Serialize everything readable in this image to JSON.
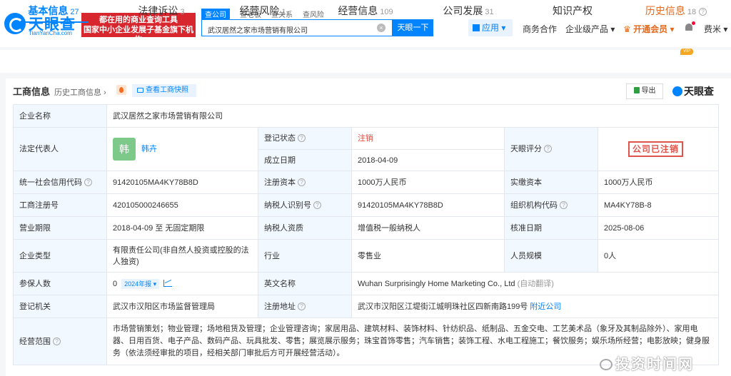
{
  "header": {
    "logo_name": "天眼查",
    "logo_sub": "TianYanCha.com",
    "banner_line1": "都在用的商业查询工具",
    "banner_line2": "国家中小企业发展子基金旗下机构",
    "search_tabs": [
      "查公司",
      "查老板",
      "查关系",
      "查风险"
    ],
    "search_value": "武汉居然之家市场营销有限公司",
    "search_button": "天眼一下",
    "app_menu": "应用",
    "nav": [
      "商务合作",
      "企业级产品"
    ],
    "vip": "开通会员",
    "user": "费米"
  },
  "tabs": [
    {
      "label": "基本信息",
      "count": "27"
    },
    {
      "label": "法律诉讼",
      "count": "3"
    },
    {
      "label": "经营风险",
      "count": "1"
    },
    {
      "label": "经营信息",
      "count": "109"
    },
    {
      "label": "公司发展",
      "count": "31"
    },
    {
      "label": "知识产权",
      "count": ""
    },
    {
      "label": "历史信息",
      "count": "18",
      "badge": "VIP"
    }
  ],
  "panel": {
    "title": "工商信息",
    "history_link": "历史工商信息",
    "snapshot_button": "查看工商快照",
    "export_button": "导出",
    "brand": "天眼查"
  },
  "info": {
    "company_name_label": "企业名称",
    "company_name": "武汉居然之家市场营销有限公司",
    "legal_rep_label": "法定代表人",
    "legal_rep_avatar": "韩",
    "legal_rep": "韩卉",
    "reg_status_label": "登记状态",
    "reg_status": "注销",
    "founded_label": "成立日期",
    "founded": "2018-04-09",
    "score_label": "天眼评分",
    "score_stamp": "公司已注销",
    "credit_code_label": "统一社会信用代码",
    "credit_code": "91420105MA4KY78B8D",
    "reg_capital_label": "注册资本",
    "reg_capital": "1000万人民币",
    "paid_capital_label": "实缴资本",
    "paid_capital": "1000万人民币",
    "reg_no_label": "工商注册号",
    "reg_no": "420105000246655",
    "taxpayer_id_label": "纳税人识别号",
    "taxpayer_id": "91420105MA4KY78B8D",
    "org_code_label": "组织机构代码",
    "org_code": "MA4KY78B-8",
    "term_label": "营业期限",
    "term": "2018-04-09 至 无固定期限",
    "taxpayer_type_label": "纳税人资质",
    "taxpayer_type": "增值税一般纳税人",
    "approval_date_label": "核准日期",
    "approval_date": "2025-08-06",
    "company_type_label": "企业类型",
    "company_type": "有限责任公司(非自然人投资或控股的法人独资)",
    "industry_label": "行业",
    "industry": "零售业",
    "staff_size_label": "人员规模",
    "staff_size": "0人",
    "insured_label": "参保人数",
    "insured": "0",
    "insured_year": "2024年报",
    "en_name_label": "英文名称",
    "en_name": "Wuhan Surprisingly Home Marketing Co., Ltd",
    "auto_translate": "(自动翻译)",
    "authority_label": "登记机关",
    "authority": "武汉市汉阳区市场监督管理局",
    "address_label": "注册地址",
    "address": "武汉市汉阳区江堤街江城明珠社区四新南路199号",
    "nearby_link": "附近公司",
    "scope_label": "经营范围",
    "scope": "市场营销策划；物业管理；场地租赁及管理；企业管理咨询；家居用品、建筑材料、装饰材料、针纺织品、纸制品、五金交电、工艺美术品（象牙及其制品除外）、家用电器、日用百货、电子产品、数码产品、玩具批发、零售；展览展示服务；珠宝首饰零售；汽车销售；装饰工程、水电工程施工；餐饮服务；娱乐场所经营；电影放映；健身服务（依法须经审批的项目，经相关部门审批后方可开展经营活动）。"
  },
  "watermark": "投资时间网"
}
